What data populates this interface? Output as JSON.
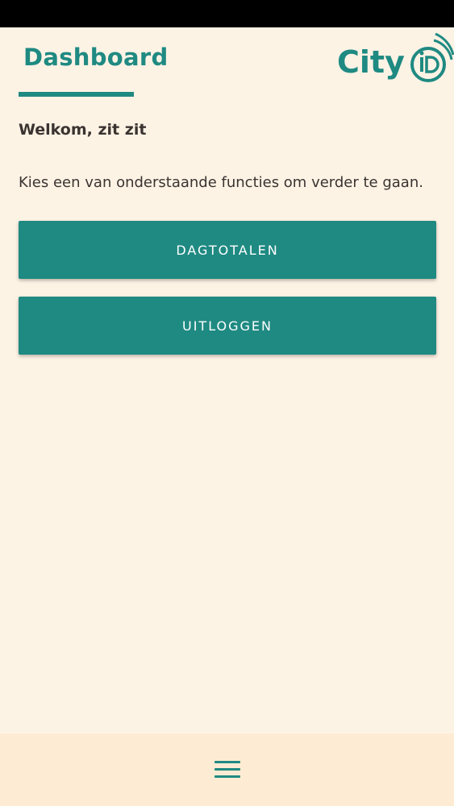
{
  "header": {
    "title": "Dashboard",
    "logo_icon": "cityid-logo",
    "logo_text": "CityiD"
  },
  "main": {
    "welcome": "Welkom, zit zit",
    "instructions": "Kies een van onderstaande functies om verder te gaan.",
    "buttons": {
      "dagtotalen": "DAGTOTALEN",
      "uitloggen": "UITLOGGEN"
    }
  },
  "bottom_bar": {
    "menu_icon": "hamburger-menu-icon"
  },
  "colors": {
    "accent": "#1f8a82",
    "background": "#fdf3e5",
    "bottom_bar": "#fdecd3",
    "text": "#3a3330"
  }
}
